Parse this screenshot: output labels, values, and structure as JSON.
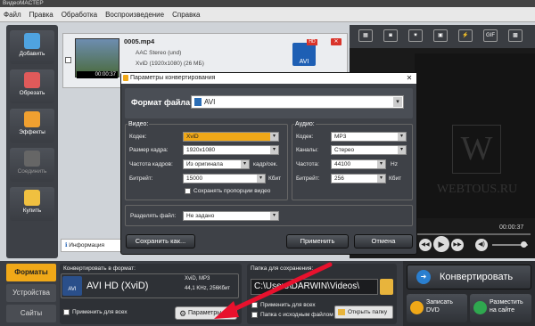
{
  "window": {
    "title": "ВидеоМАСТЕР"
  },
  "menu": [
    "Файл",
    "Правка",
    "Обработка",
    "Воспроизведение",
    "Справка"
  ],
  "left_tools": [
    {
      "label": "Добавить",
      "color": "#4fa3e0"
    },
    {
      "label": "Обрезать",
      "color": "#e05a5a"
    },
    {
      "label": "Эффекты",
      "color": "#f0a030"
    },
    {
      "label": "Соединить",
      "color": "#777"
    },
    {
      "label": "Купить",
      "color": "#f0c040"
    }
  ],
  "file": {
    "name": "0005.mp4",
    "audio": "AAC Stereo (und)",
    "video": "XviD (1920x1080) (26 МБ)",
    "duration": "00:00:37",
    "badge": "AVI",
    "badge_hd": "HD"
  },
  "right_tools": [
    "▦",
    "◙",
    "✷",
    "▣",
    "⚡",
    "GIF",
    "▩"
  ],
  "watermark": {
    "letter": "W",
    "text": "WEBTOUS.RU"
  },
  "player": {
    "time": "00:00:37"
  },
  "dialog": {
    "title": "Параметры конвертирования",
    "format_label": "Формат файла:",
    "format_value": "AVI",
    "video": {
      "heading": "Видео:",
      "codec_label": "Кодек:",
      "codec": "XviD",
      "size_label": "Размер кадра:",
      "size": "1920x1080",
      "fps_label": "Частота кадров:",
      "fps": "Из оригинала",
      "fps_unit": "кадр/сек.",
      "bitrate_label": "Битрейт:",
      "bitrate": "15000",
      "bitrate_unit": "Кбит",
      "keep_aspect": "Сохранять пропорции видео"
    },
    "audio": {
      "heading": "Аудио:",
      "codec_label": "Кодек:",
      "codec": "MP3",
      "channels_label": "Каналы:",
      "channels": "Стерео",
      "freq_label": "Частота:",
      "freq": "44100",
      "freq_unit": "Hz",
      "bitrate_label": "Битрейт:",
      "bitrate": "256",
      "bitrate_unit": "Кбит"
    },
    "split_label": "Разделять файл:",
    "split_value": "Не задано",
    "save_as": "Сохранить как...",
    "apply": "Применить",
    "cancel": "Отмена"
  },
  "info_tab": "Информация",
  "bottom": {
    "tabs": [
      "Форматы",
      "Устройства",
      "Сайты"
    ],
    "convert_to_label": "Конвертировать в формат:",
    "format_name": "AVI HD (XviD)",
    "format_details": [
      "XviD, MP3",
      "44,1 KHz, 256Кбит"
    ],
    "apply_all": "Применить для всех",
    "params": "Параметры",
    "save_folder_label": "Папка для сохранения:",
    "folder_path": "C:\\Users\\DARWIN\\Videos\\",
    "apply_all2": "Применить для всех",
    "source_folder": "Папка с исходным файлом",
    "open_folder": "Открыть папку",
    "convert": "Конвертировать",
    "burn_dvd": [
      "Записать",
      "DVD"
    ],
    "publish": [
      "Разместить",
      "на сайте"
    ]
  },
  "colors": {
    "accent": "#f0a818",
    "arrow": "#e8112d"
  }
}
